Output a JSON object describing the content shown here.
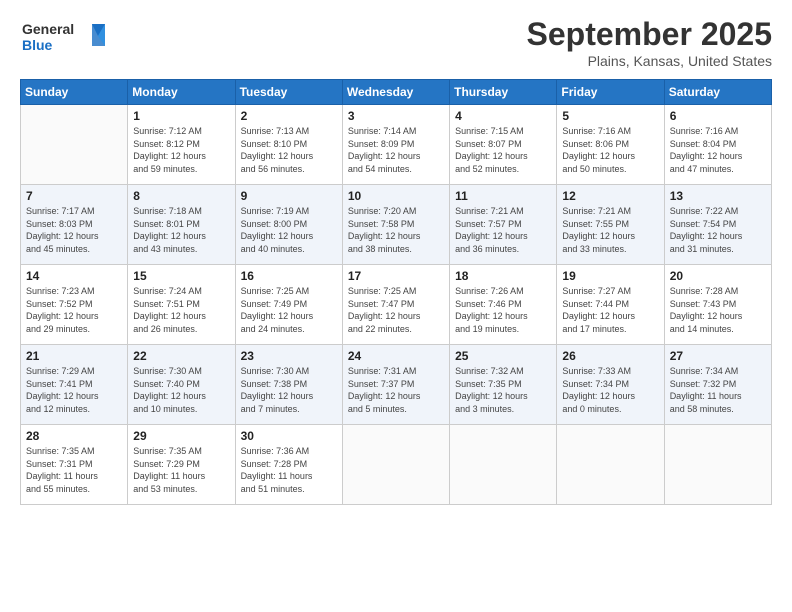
{
  "logo": {
    "line1": "General",
    "line2": "Blue"
  },
  "title": "September 2025",
  "location": "Plains, Kansas, United States",
  "weekdays": [
    "Sunday",
    "Monday",
    "Tuesday",
    "Wednesday",
    "Thursday",
    "Friday",
    "Saturday"
  ],
  "weeks": [
    [
      {
        "day": "",
        "info": ""
      },
      {
        "day": "1",
        "info": "Sunrise: 7:12 AM\nSunset: 8:12 PM\nDaylight: 12 hours\nand 59 minutes."
      },
      {
        "day": "2",
        "info": "Sunrise: 7:13 AM\nSunset: 8:10 PM\nDaylight: 12 hours\nand 56 minutes."
      },
      {
        "day": "3",
        "info": "Sunrise: 7:14 AM\nSunset: 8:09 PM\nDaylight: 12 hours\nand 54 minutes."
      },
      {
        "day": "4",
        "info": "Sunrise: 7:15 AM\nSunset: 8:07 PM\nDaylight: 12 hours\nand 52 minutes."
      },
      {
        "day": "5",
        "info": "Sunrise: 7:16 AM\nSunset: 8:06 PM\nDaylight: 12 hours\nand 50 minutes."
      },
      {
        "day": "6",
        "info": "Sunrise: 7:16 AM\nSunset: 8:04 PM\nDaylight: 12 hours\nand 47 minutes."
      }
    ],
    [
      {
        "day": "7",
        "info": "Sunrise: 7:17 AM\nSunset: 8:03 PM\nDaylight: 12 hours\nand 45 minutes."
      },
      {
        "day": "8",
        "info": "Sunrise: 7:18 AM\nSunset: 8:01 PM\nDaylight: 12 hours\nand 43 minutes."
      },
      {
        "day": "9",
        "info": "Sunrise: 7:19 AM\nSunset: 8:00 PM\nDaylight: 12 hours\nand 40 minutes."
      },
      {
        "day": "10",
        "info": "Sunrise: 7:20 AM\nSunset: 7:58 PM\nDaylight: 12 hours\nand 38 minutes."
      },
      {
        "day": "11",
        "info": "Sunrise: 7:21 AM\nSunset: 7:57 PM\nDaylight: 12 hours\nand 36 minutes."
      },
      {
        "day": "12",
        "info": "Sunrise: 7:21 AM\nSunset: 7:55 PM\nDaylight: 12 hours\nand 33 minutes."
      },
      {
        "day": "13",
        "info": "Sunrise: 7:22 AM\nSunset: 7:54 PM\nDaylight: 12 hours\nand 31 minutes."
      }
    ],
    [
      {
        "day": "14",
        "info": "Sunrise: 7:23 AM\nSunset: 7:52 PM\nDaylight: 12 hours\nand 29 minutes."
      },
      {
        "day": "15",
        "info": "Sunrise: 7:24 AM\nSunset: 7:51 PM\nDaylight: 12 hours\nand 26 minutes."
      },
      {
        "day": "16",
        "info": "Sunrise: 7:25 AM\nSunset: 7:49 PM\nDaylight: 12 hours\nand 24 minutes."
      },
      {
        "day": "17",
        "info": "Sunrise: 7:25 AM\nSunset: 7:47 PM\nDaylight: 12 hours\nand 22 minutes."
      },
      {
        "day": "18",
        "info": "Sunrise: 7:26 AM\nSunset: 7:46 PM\nDaylight: 12 hours\nand 19 minutes."
      },
      {
        "day": "19",
        "info": "Sunrise: 7:27 AM\nSunset: 7:44 PM\nDaylight: 12 hours\nand 17 minutes."
      },
      {
        "day": "20",
        "info": "Sunrise: 7:28 AM\nSunset: 7:43 PM\nDaylight: 12 hours\nand 14 minutes."
      }
    ],
    [
      {
        "day": "21",
        "info": "Sunrise: 7:29 AM\nSunset: 7:41 PM\nDaylight: 12 hours\nand 12 minutes."
      },
      {
        "day": "22",
        "info": "Sunrise: 7:30 AM\nSunset: 7:40 PM\nDaylight: 12 hours\nand 10 minutes."
      },
      {
        "day": "23",
        "info": "Sunrise: 7:30 AM\nSunset: 7:38 PM\nDaylight: 12 hours\nand 7 minutes."
      },
      {
        "day": "24",
        "info": "Sunrise: 7:31 AM\nSunset: 7:37 PM\nDaylight: 12 hours\nand 5 minutes."
      },
      {
        "day": "25",
        "info": "Sunrise: 7:32 AM\nSunset: 7:35 PM\nDaylight: 12 hours\nand 3 minutes."
      },
      {
        "day": "26",
        "info": "Sunrise: 7:33 AM\nSunset: 7:34 PM\nDaylight: 12 hours\nand 0 minutes."
      },
      {
        "day": "27",
        "info": "Sunrise: 7:34 AM\nSunset: 7:32 PM\nDaylight: 11 hours\nand 58 minutes."
      }
    ],
    [
      {
        "day": "28",
        "info": "Sunrise: 7:35 AM\nSunset: 7:31 PM\nDaylight: 11 hours\nand 55 minutes."
      },
      {
        "day": "29",
        "info": "Sunrise: 7:35 AM\nSunset: 7:29 PM\nDaylight: 11 hours\nand 53 minutes."
      },
      {
        "day": "30",
        "info": "Sunrise: 7:36 AM\nSunset: 7:28 PM\nDaylight: 11 hours\nand 51 minutes."
      },
      {
        "day": "",
        "info": ""
      },
      {
        "day": "",
        "info": ""
      },
      {
        "day": "",
        "info": ""
      },
      {
        "day": "",
        "info": ""
      }
    ]
  ]
}
